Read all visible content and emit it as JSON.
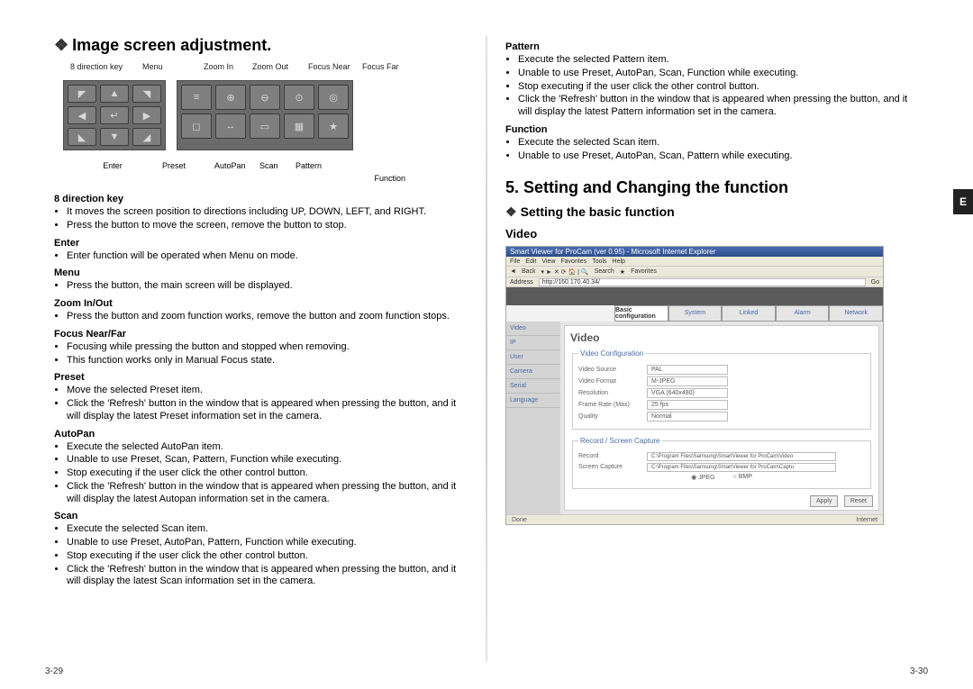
{
  "left": {
    "heading": "Image screen adjustment.",
    "diagram": {
      "top_labels": {
        "l1": "8 direction key",
        "l2": "Menu",
        "l3": "Zoom In",
        "l4": "Zoom Out",
        "l5": "Focus Near",
        "l6": "Focus Far"
      },
      "bot_labels": {
        "b1": "Enter",
        "b2": "Preset",
        "b3": "AutoPan",
        "b4": "Scan",
        "b5": "Pattern",
        "b6": "Function"
      }
    },
    "sections": {
      "s1": {
        "title": "8 direction key",
        "i1": "It moves the screen position to directions including UP, DOWN, LEFT, and RIGHT.",
        "i2": "Press the button to move the screen, remove the button to stop."
      },
      "s2": {
        "title": "Enter",
        "i1": "Enter function will be operated when Menu on mode."
      },
      "s3": {
        "title": "Menu",
        "i1": "Press the button, the main screen will be displayed."
      },
      "s4": {
        "title": "Zoom In/Out",
        "i1": "Press the button and zoom function works, remove the button and zoom function stops."
      },
      "s5": {
        "title": "Focus Near/Far",
        "i1": "Focusing while pressing the button and stopped when removing.",
        "i2": "This function works only in Manual Focus state."
      },
      "s6": {
        "title": "Preset",
        "i1": "Move the selected Preset item.",
        "i2": "Click the 'Refresh' button in the window that is appeared when pressing the button, and it will display the latest Preset information set in the camera."
      },
      "s7": {
        "title": "AutoPan",
        "i1": "Execute the selected AutoPan item.",
        "i2": "Unable to use Preset, Scan, Pattern, Function while executing.",
        "i3": "Stop executing if the user click the other control button.",
        "i4": "Click the 'Refresh' button in the window that is appeared when pressing the button, and it will display the latest Autopan information set in the camera."
      },
      "s8": {
        "title": "Scan",
        "i1": "Execute the selected Scan item.",
        "i2": "Unable to use Preset, AutoPan, Pattern, Function while executing.",
        "i3": "Stop executing if the user click the other control button.",
        "i4": "Click the 'Refresh' button in the window that is appeared when pressing the button, and it will display the latest Scan information set in the camera."
      }
    },
    "footer": "3-29"
  },
  "right": {
    "sections": {
      "p": {
        "title": "Pattern",
        "i1": "Execute the selected Pattern item.",
        "i2": "Unable to use Preset, AutoPan, Scan, Function while executing.",
        "i3": "Stop executing if the user click the other control button.",
        "i4": "Click the 'Refresh' button in the window that is appeared when pressing the button, and it will display the latest Pattern information set in the camera."
      },
      "f": {
        "title": "Function",
        "i1": "Execute the selected Scan item.",
        "i2": "Unable to use Preset, AutoPan, Scan, Pattern while executing."
      }
    },
    "h1": "5. Setting and Changing the function",
    "h2": "Setting the basic function",
    "h3": "Video",
    "tab_e": "E",
    "shot": {
      "title": "Smart Viewer for ProCam (ver 0.95) - Microsoft Internet Explorer",
      "menu": {
        "m1": "File",
        "m2": "Edit",
        "m3": "View",
        "m4": "Favorites",
        "m5": "Tools",
        "m6": "Help"
      },
      "toolbar": {
        "back": "Back",
        "search": "Search",
        "fav": "Favorites"
      },
      "addr_label": "Address",
      "addr": "http://160.170.40.34/",
      "go": "Go",
      "tabs": {
        "t1": "Basic configuration",
        "t2": "System",
        "t3": "Linked",
        "t4": "Alarm",
        "t5": "Network"
      },
      "nav": {
        "n1": "Video",
        "n2": "IP",
        "n3": "User",
        "n4": "Camera",
        "n5": "Serial",
        "n6": "Language"
      },
      "content_title": "Video",
      "fs1_title": "Video Configuration",
      "row1_l": "Video Source",
      "row1_v": "PAL",
      "row2_l": "Video Format",
      "row2_v": "M-JPEG",
      "row3_l": "Resolution",
      "row3_v": "VGA (640x480)",
      "row4_l": "Frame Rate (Max)",
      "row4_v": "25 fps",
      "row5_l": "Quality",
      "row5_v": "Normal",
      "fs2_title": "Record / Screen Capture",
      "row6_l": "Record",
      "row6_v": "C:\\Program Files\\Samsung\\SmartViewer for ProCam\\Video",
      "row7_l": "Screen Capture",
      "row7_v": "C:\\Program Files\\Samsung\\SmartViewer for ProCam\\Captu",
      "radio1": "JPEG",
      "radio2": "BMP",
      "apply": "Apply",
      "reset": "Reset",
      "status_l": "Done",
      "status_r": "Internet"
    },
    "footer": "3-30"
  }
}
